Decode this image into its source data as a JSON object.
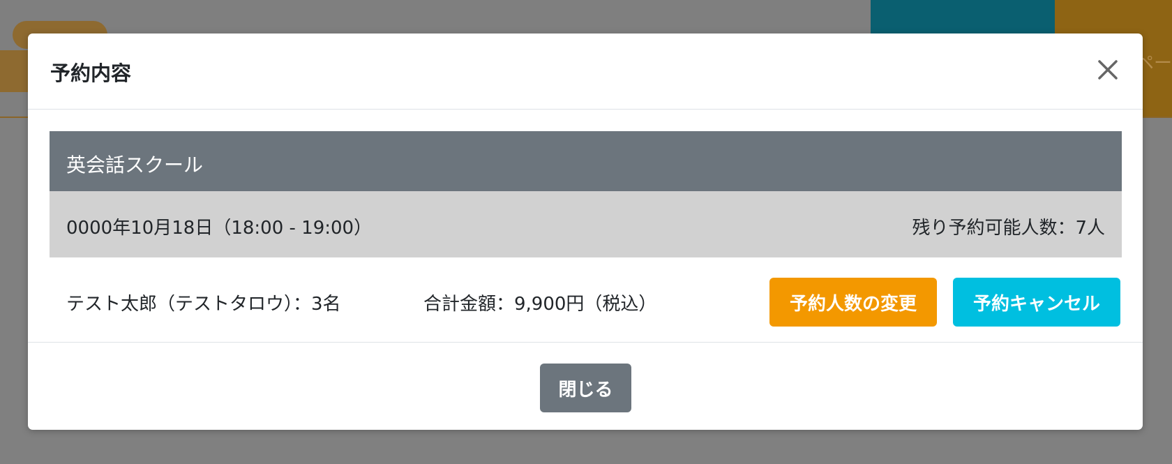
{
  "background": {
    "header_partial_text": "ペー"
  },
  "modal": {
    "title": "予約内容",
    "close_icon": "close-icon",
    "course": {
      "name": "英会話スクール"
    },
    "schedule": {
      "date_time": "0000年10月18日（18:00 - 19:00）",
      "remaining": "残り予約可能人数：7人"
    },
    "booking": {
      "name_and_count": "テスト太郎（テストタロウ）：3名",
      "total": "合計金額：9,900円（税込）"
    },
    "buttons": {
      "change_label": "予約人数の変更",
      "cancel_label": "予約キャンセル",
      "close_label": "閉じる"
    }
  },
  "colors": {
    "overlay": "#808080",
    "course_bar": "#6c757d",
    "date_bar": "#d1d1d1",
    "change_button": "#f39800",
    "cancel_button": "#00bfe0",
    "close_button": "#6c757d"
  }
}
